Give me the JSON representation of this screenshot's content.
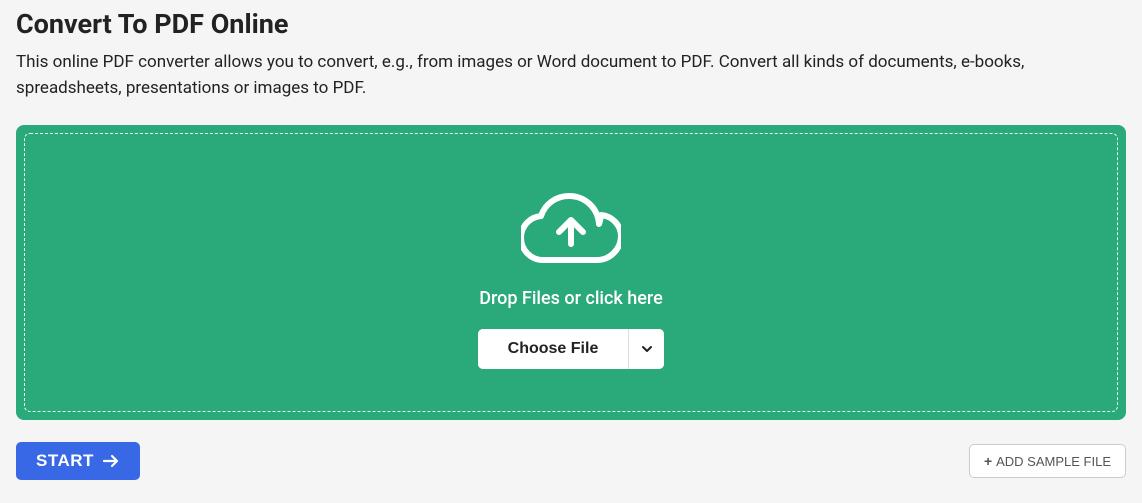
{
  "header": {
    "title": "Convert To PDF Online",
    "description": "This online PDF converter allows you to convert, e.g., from images or Word document to PDF. Convert all kinds of documents, e-books, spreadsheets, presentations or images to PDF."
  },
  "dropzone": {
    "instruction": "Drop Files or click here",
    "choose_file_label": "Choose File"
  },
  "footer": {
    "start_label": "START",
    "add_sample_label": "ADD SAMPLE FILE"
  }
}
